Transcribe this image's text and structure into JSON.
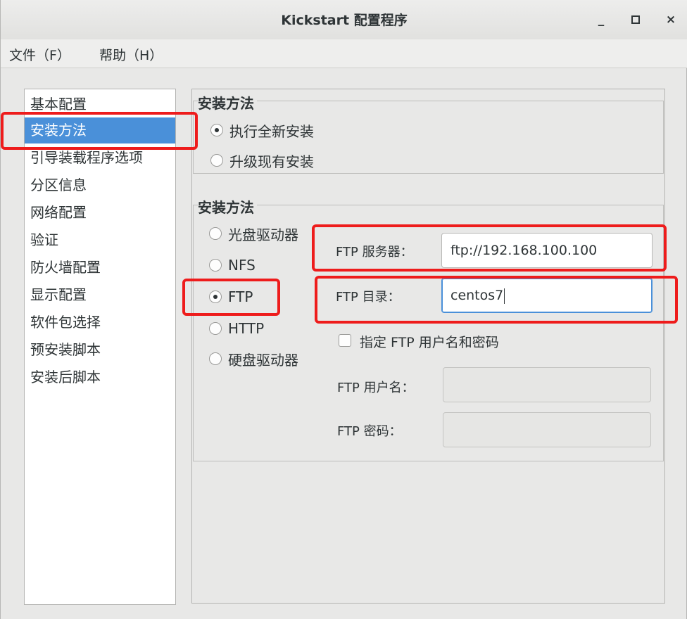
{
  "window": {
    "title": "Kickstart 配置程序",
    "minimize": "_",
    "maximize": "□",
    "close": "×"
  },
  "menubar": {
    "file": "文件（F）",
    "help": "帮助（H）"
  },
  "sidebar": {
    "items": [
      {
        "label": "基本配置"
      },
      {
        "label": "安装方法"
      },
      {
        "label": "引导装载程序选项"
      },
      {
        "label": "分区信息"
      },
      {
        "label": "网络配置"
      },
      {
        "label": "验证"
      },
      {
        "label": "防火墙配置"
      },
      {
        "label": "显示配置"
      },
      {
        "label": "软件包选择"
      },
      {
        "label": "预安装脚本"
      },
      {
        "label": "安装后脚本"
      }
    ],
    "selected": "安装方法"
  },
  "install_type": {
    "title": "安装方法",
    "options": [
      {
        "label": "执行全新安装",
        "checked": true
      },
      {
        "label": "升级现有安装",
        "checked": false
      }
    ]
  },
  "install_source": {
    "title": "安装方法",
    "options": [
      {
        "label": "光盘驱动器",
        "checked": false
      },
      {
        "label": "NFS",
        "checked": false
      },
      {
        "label": "FTP",
        "checked": true
      },
      {
        "label": "HTTP",
        "checked": false
      },
      {
        "label": "硬盘驱动器",
        "checked": false
      }
    ],
    "ftp_server_label": "FTP 服务器：",
    "ftp_server_value": "ftp://192.168.100.100",
    "ftp_dir_label": "FTP 目录：",
    "ftp_dir_value": "centos7",
    "specify_user_label": "指定  FTP 用户名和密码",
    "ftp_user_label": "FTP 用户名：",
    "ftp_user_value": "",
    "ftp_password_label": "FTP 密码：",
    "ftp_password_value": ""
  },
  "colors": {
    "selection": "#4a90d9",
    "highlight_box": "#ee1c1c"
  }
}
